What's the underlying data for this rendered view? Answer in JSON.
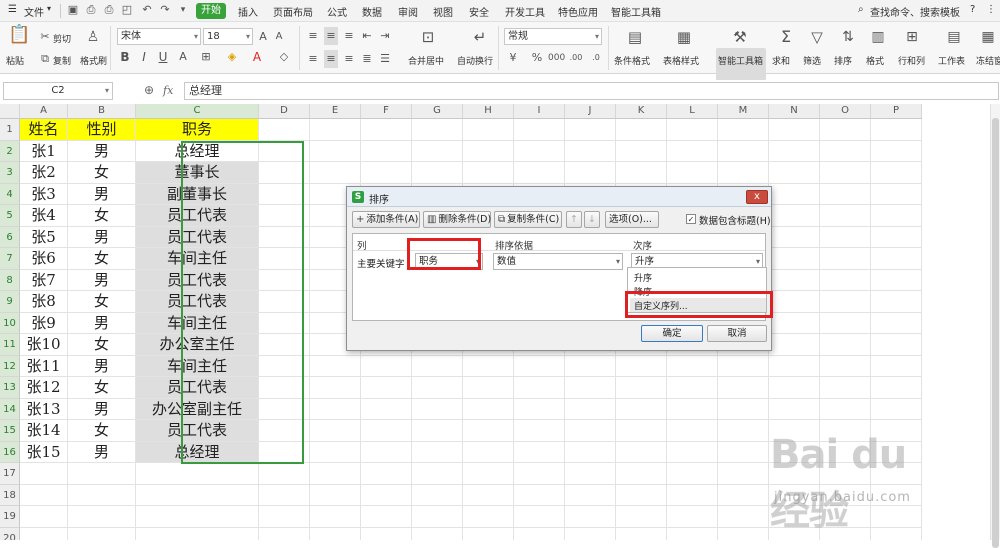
{
  "menubar": {
    "file_menu": "文件",
    "tabs": [
      "开始",
      "插入",
      "页面布局",
      "公式",
      "数据",
      "审阅",
      "视图",
      "安全",
      "开发工具",
      "特色应用",
      "智能工具箱"
    ],
    "search": "查找命令、搜索模板",
    "help": "?"
  },
  "ribbon": {
    "paste": "粘贴",
    "cut": "剪切",
    "copy": "复制",
    "format_painter": "格式刷",
    "font_name": "宋体",
    "font_size": "18",
    "merge_center": "合并居中",
    "wrap_text": "自动换行",
    "number_format": "常规",
    "conditional_format": "条件格式",
    "table_style": "表格样式",
    "smart_toolbox": "智能工具箱",
    "sum": "求和",
    "filter": "筛选",
    "sort": "排序",
    "format": "格式",
    "rows_cols": "行和列",
    "worksheet": "工作表",
    "freeze": "冻结窗"
  },
  "formula_bar": {
    "name_box": "C2",
    "fx": "fx",
    "content": "总经理"
  },
  "sheet": {
    "columns": [
      "A",
      "B",
      "C",
      "D",
      "E",
      "F",
      "G",
      "H",
      "I",
      "J",
      "K",
      "L",
      "M",
      "N",
      "O",
      "P"
    ],
    "header_row": [
      "姓名",
      "性别",
      "职务"
    ],
    "rows": [
      [
        "张1",
        "男",
        "总经理"
      ],
      [
        "张2",
        "女",
        "董事长"
      ],
      [
        "张3",
        "男",
        "副董事长"
      ],
      [
        "张4",
        "女",
        "员工代表"
      ],
      [
        "张5",
        "男",
        "员工代表"
      ],
      [
        "张6",
        "女",
        "车间主任"
      ],
      [
        "张7",
        "男",
        "员工代表"
      ],
      [
        "张8",
        "女",
        "员工代表"
      ],
      [
        "张9",
        "男",
        "车间主任"
      ],
      [
        "张10",
        "女",
        "办公室主任"
      ],
      [
        "张11",
        "男",
        "车间主任"
      ],
      [
        "张12",
        "女",
        "员工代表"
      ],
      [
        "张13",
        "男",
        "办公室副主任"
      ],
      [
        "张14",
        "女",
        "员工代表"
      ],
      [
        "张15",
        "男",
        "总经理"
      ]
    ],
    "row_numbers": [
      "1",
      "2",
      "3",
      "4",
      "5",
      "6",
      "7",
      "8",
      "9",
      "10",
      "11",
      "12",
      "13",
      "14",
      "15",
      "16",
      "17",
      "18",
      "19",
      "20"
    ]
  },
  "dialog": {
    "logo": "S",
    "title": "排序",
    "close": "x",
    "add_condition": "添加条件(A)",
    "delete_condition": "删除条件(D)",
    "copy_condition": "复制条件(C)",
    "options": "选项(O)...",
    "has_header_label": "数据包含标题(H)",
    "has_header_checked": true,
    "col_header_column": "列",
    "col_header_basis": "排序依据",
    "col_header_order": "次序",
    "primary_key_label": "主要关键字",
    "primary_key_value": "职务",
    "sort_basis_value": "数值",
    "order_value": "升序",
    "order_options": [
      "升序",
      "降序",
      "自定义序列..."
    ],
    "ok": "确定",
    "cancel": "取消"
  },
  "watermark": {
    "brand": "Bai du 经验",
    "url": "jingyan.baidu.com"
  },
  "colors": {
    "accent_green": "#37a33a",
    "header_yellow": "#ffff00",
    "highlight_red": "#e02020"
  }
}
